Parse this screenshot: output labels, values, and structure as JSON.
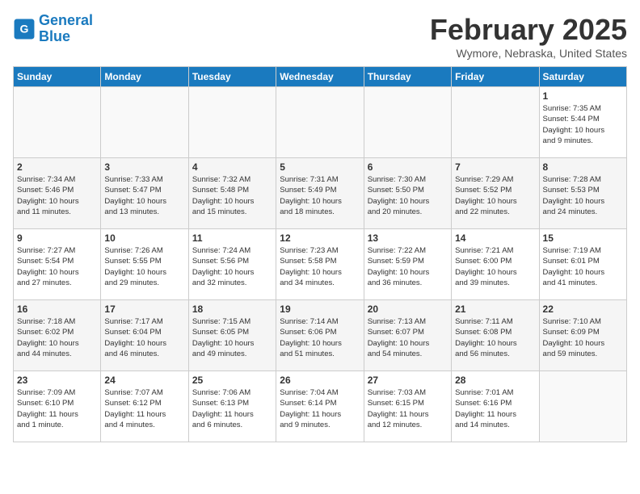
{
  "header": {
    "logo_line1": "General",
    "logo_line2": "Blue",
    "month": "February 2025",
    "location": "Wymore, Nebraska, United States"
  },
  "days_of_week": [
    "Sunday",
    "Monday",
    "Tuesday",
    "Wednesday",
    "Thursday",
    "Friday",
    "Saturday"
  ],
  "weeks": [
    [
      {
        "num": "",
        "info": ""
      },
      {
        "num": "",
        "info": ""
      },
      {
        "num": "",
        "info": ""
      },
      {
        "num": "",
        "info": ""
      },
      {
        "num": "",
        "info": ""
      },
      {
        "num": "",
        "info": ""
      },
      {
        "num": "1",
        "info": "Sunrise: 7:35 AM\nSunset: 5:44 PM\nDaylight: 10 hours\nand 9 minutes."
      }
    ],
    [
      {
        "num": "2",
        "info": "Sunrise: 7:34 AM\nSunset: 5:46 PM\nDaylight: 10 hours\nand 11 minutes."
      },
      {
        "num": "3",
        "info": "Sunrise: 7:33 AM\nSunset: 5:47 PM\nDaylight: 10 hours\nand 13 minutes."
      },
      {
        "num": "4",
        "info": "Sunrise: 7:32 AM\nSunset: 5:48 PM\nDaylight: 10 hours\nand 15 minutes."
      },
      {
        "num": "5",
        "info": "Sunrise: 7:31 AM\nSunset: 5:49 PM\nDaylight: 10 hours\nand 18 minutes."
      },
      {
        "num": "6",
        "info": "Sunrise: 7:30 AM\nSunset: 5:50 PM\nDaylight: 10 hours\nand 20 minutes."
      },
      {
        "num": "7",
        "info": "Sunrise: 7:29 AM\nSunset: 5:52 PM\nDaylight: 10 hours\nand 22 minutes."
      },
      {
        "num": "8",
        "info": "Sunrise: 7:28 AM\nSunset: 5:53 PM\nDaylight: 10 hours\nand 24 minutes."
      }
    ],
    [
      {
        "num": "9",
        "info": "Sunrise: 7:27 AM\nSunset: 5:54 PM\nDaylight: 10 hours\nand 27 minutes."
      },
      {
        "num": "10",
        "info": "Sunrise: 7:26 AM\nSunset: 5:55 PM\nDaylight: 10 hours\nand 29 minutes."
      },
      {
        "num": "11",
        "info": "Sunrise: 7:24 AM\nSunset: 5:56 PM\nDaylight: 10 hours\nand 32 minutes."
      },
      {
        "num": "12",
        "info": "Sunrise: 7:23 AM\nSunset: 5:58 PM\nDaylight: 10 hours\nand 34 minutes."
      },
      {
        "num": "13",
        "info": "Sunrise: 7:22 AM\nSunset: 5:59 PM\nDaylight: 10 hours\nand 36 minutes."
      },
      {
        "num": "14",
        "info": "Sunrise: 7:21 AM\nSunset: 6:00 PM\nDaylight: 10 hours\nand 39 minutes."
      },
      {
        "num": "15",
        "info": "Sunrise: 7:19 AM\nSunset: 6:01 PM\nDaylight: 10 hours\nand 41 minutes."
      }
    ],
    [
      {
        "num": "16",
        "info": "Sunrise: 7:18 AM\nSunset: 6:02 PM\nDaylight: 10 hours\nand 44 minutes."
      },
      {
        "num": "17",
        "info": "Sunrise: 7:17 AM\nSunset: 6:04 PM\nDaylight: 10 hours\nand 46 minutes."
      },
      {
        "num": "18",
        "info": "Sunrise: 7:15 AM\nSunset: 6:05 PM\nDaylight: 10 hours\nand 49 minutes."
      },
      {
        "num": "19",
        "info": "Sunrise: 7:14 AM\nSunset: 6:06 PM\nDaylight: 10 hours\nand 51 minutes."
      },
      {
        "num": "20",
        "info": "Sunrise: 7:13 AM\nSunset: 6:07 PM\nDaylight: 10 hours\nand 54 minutes."
      },
      {
        "num": "21",
        "info": "Sunrise: 7:11 AM\nSunset: 6:08 PM\nDaylight: 10 hours\nand 56 minutes."
      },
      {
        "num": "22",
        "info": "Sunrise: 7:10 AM\nSunset: 6:09 PM\nDaylight: 10 hours\nand 59 minutes."
      }
    ],
    [
      {
        "num": "23",
        "info": "Sunrise: 7:09 AM\nSunset: 6:10 PM\nDaylight: 11 hours\nand 1 minute."
      },
      {
        "num": "24",
        "info": "Sunrise: 7:07 AM\nSunset: 6:12 PM\nDaylight: 11 hours\nand 4 minutes."
      },
      {
        "num": "25",
        "info": "Sunrise: 7:06 AM\nSunset: 6:13 PM\nDaylight: 11 hours\nand 6 minutes."
      },
      {
        "num": "26",
        "info": "Sunrise: 7:04 AM\nSunset: 6:14 PM\nDaylight: 11 hours\nand 9 minutes."
      },
      {
        "num": "27",
        "info": "Sunrise: 7:03 AM\nSunset: 6:15 PM\nDaylight: 11 hours\nand 12 minutes."
      },
      {
        "num": "28",
        "info": "Sunrise: 7:01 AM\nSunset: 6:16 PM\nDaylight: 11 hours\nand 14 minutes."
      },
      {
        "num": "",
        "info": ""
      }
    ]
  ]
}
